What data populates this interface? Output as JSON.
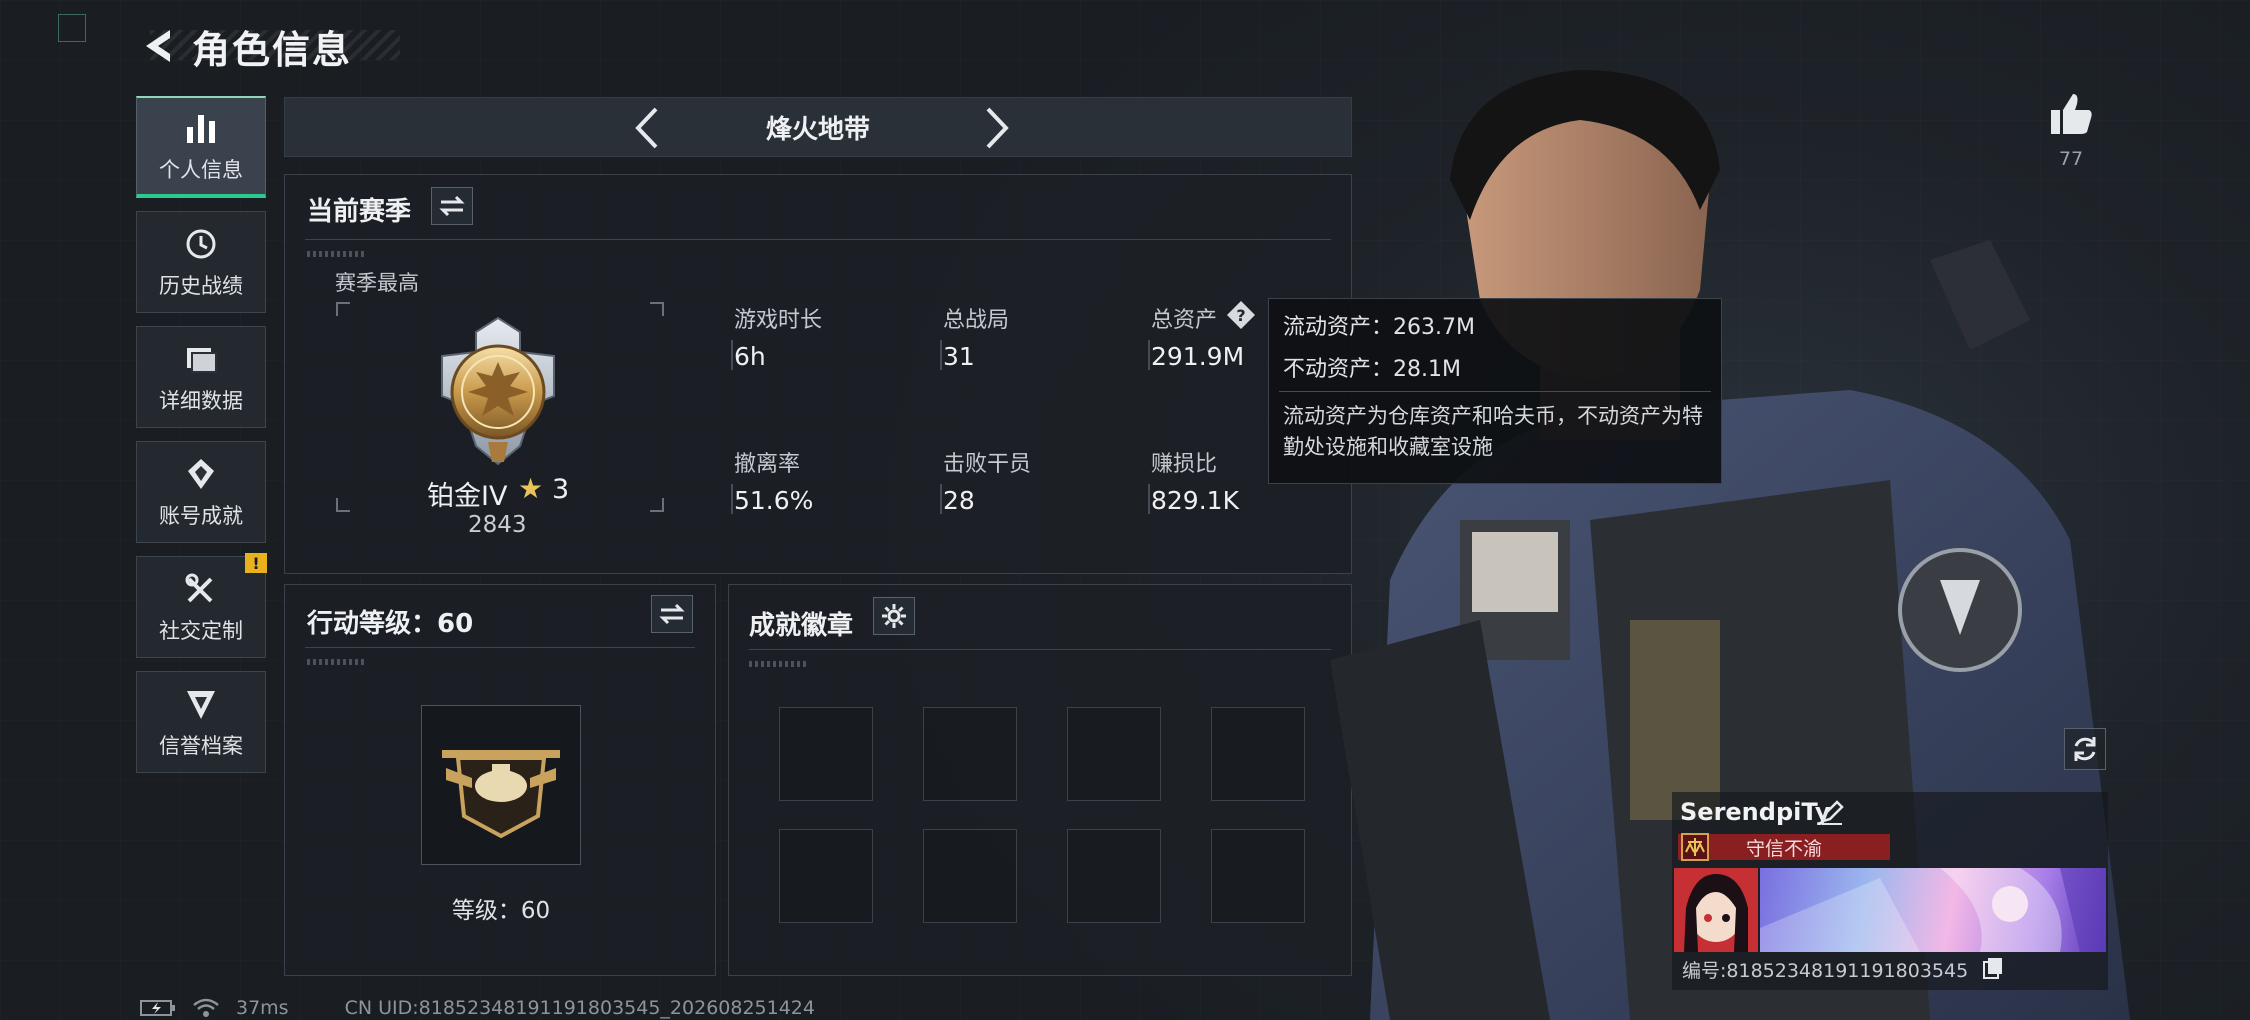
{
  "header": {
    "title": "角色信息"
  },
  "sidebar": {
    "items": [
      {
        "label": "个人信息",
        "icon": "bar-chart-icon",
        "active": true
      },
      {
        "label": "历史战绩",
        "icon": "history-icon"
      },
      {
        "label": "详细数据",
        "icon": "folder-icon"
      },
      {
        "label": "账号成就",
        "icon": "achievement-icon"
      },
      {
        "label": "社交定制",
        "icon": "tools-icon",
        "alert": "!"
      },
      {
        "label": "信誉档案",
        "icon": "shield-icon"
      }
    ]
  },
  "mode_nav": {
    "title": "烽火地带"
  },
  "season": {
    "title": "当前赛季",
    "best_label": "赛季最高",
    "rank_name": "铂金IV",
    "rank_stars": "3",
    "rank_score": "2843",
    "stats": [
      {
        "label": "游戏时长",
        "value": "6h"
      },
      {
        "label": "总战局",
        "value": "31"
      },
      {
        "label": "总资产",
        "value": "291.9M"
      },
      {
        "label": "撤离率",
        "value": "51.6%"
      },
      {
        "label": "击败干员",
        "value": "28"
      },
      {
        "label": "赚损比",
        "value": "829.1K"
      }
    ]
  },
  "action_level": {
    "title": "行动等级：60",
    "level_text": "等级：60"
  },
  "badges": {
    "title": "成就徽章",
    "slots": 8
  },
  "tooltip": {
    "liquid": "流动资产：263.7M",
    "fixed": "不动资产：28.1M",
    "note": "流动资产为仓库资产和哈夫币，不动资产为特勤处设施和收藏室设施"
  },
  "profile": {
    "likes": "77",
    "name": "SerendpiTy",
    "title": "守信不渝",
    "uid_line": "编号:818523481911918035​45"
  },
  "status_bar": {
    "ping": "37ms",
    "uid": "CN UID:818523481911918035​45_202608251424"
  },
  "colors": {
    "accent_green": "#2ec98e",
    "alert_yellow": "#e8b21e",
    "title_red": "#8a1f22"
  }
}
